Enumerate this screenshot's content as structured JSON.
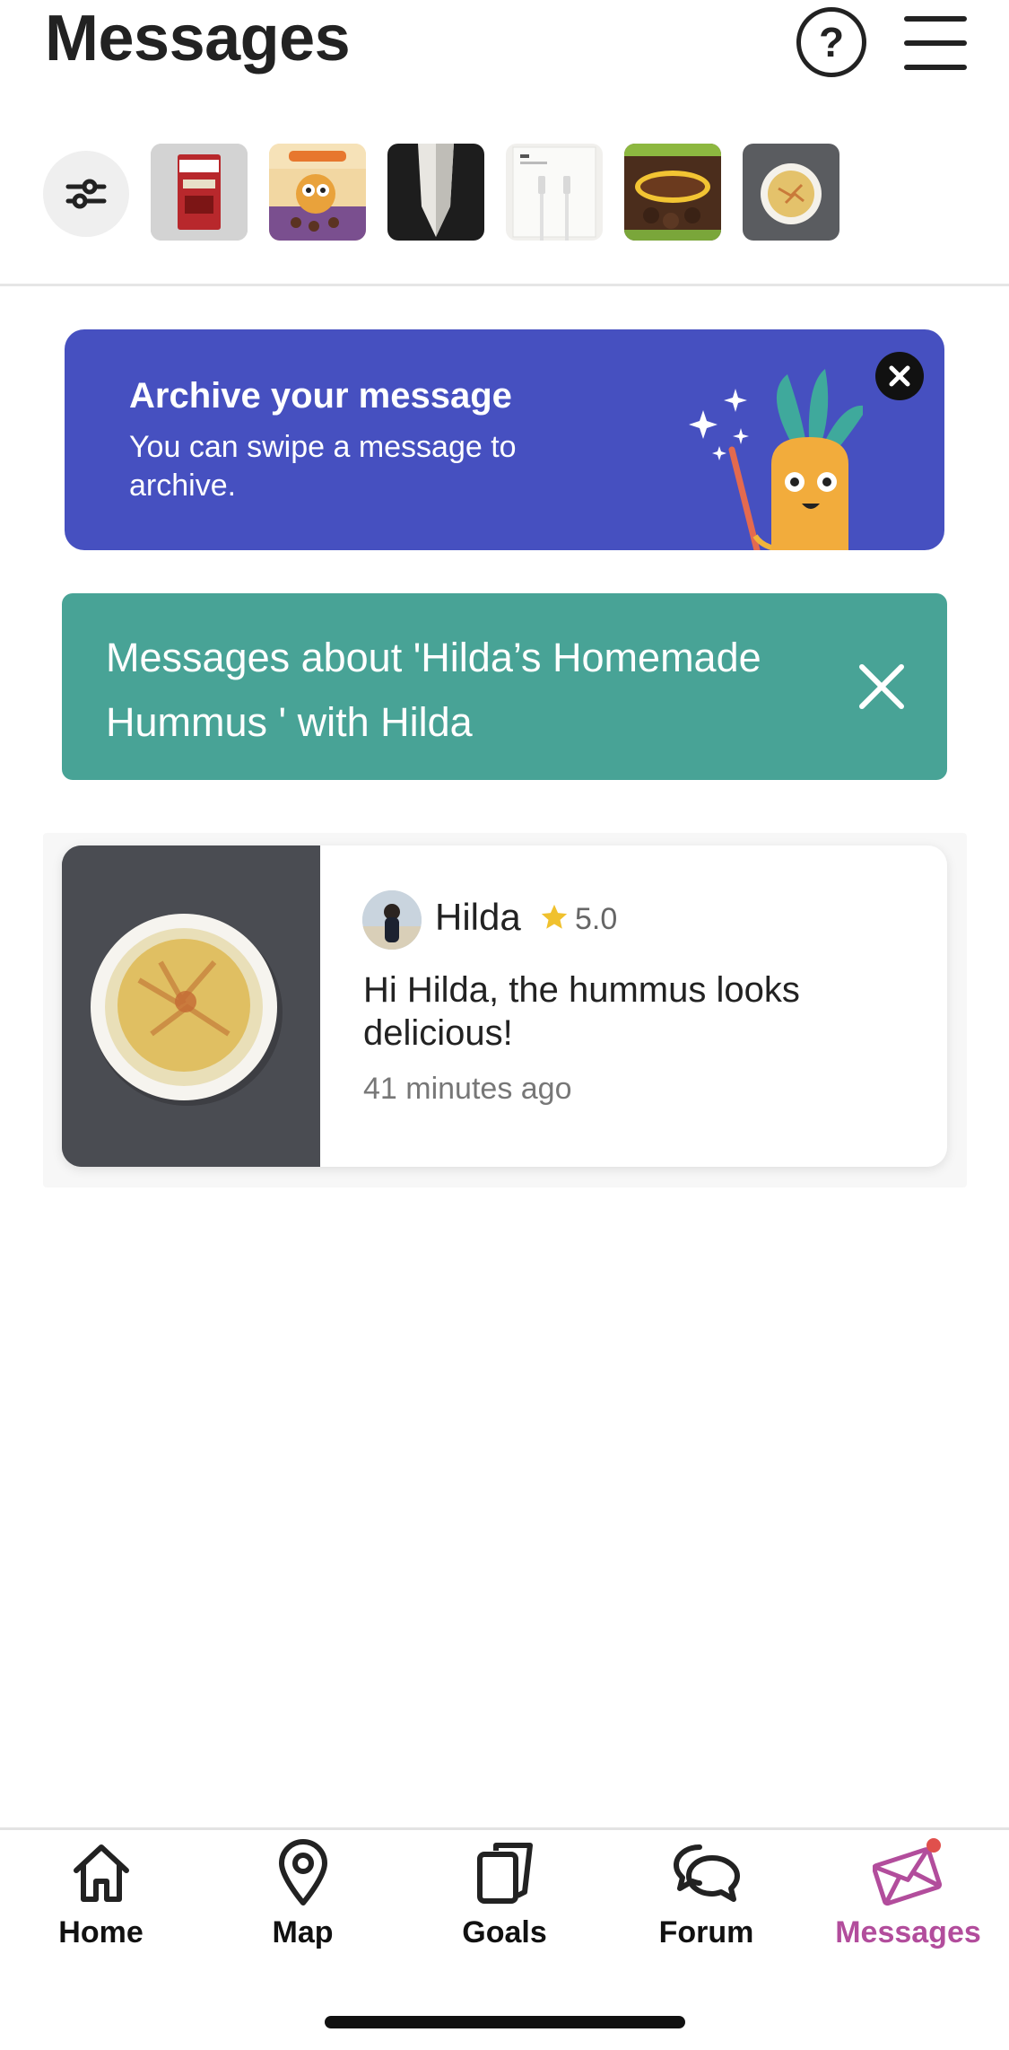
{
  "header": {
    "title": "Messages",
    "help_icon": "question-circle-icon",
    "menu_icon": "hamburger-menu-icon"
  },
  "filters": {
    "filter_icon": "sliders-icon",
    "thumbnails": [
      {
        "name": "thumbnail-ricola"
      },
      {
        "name": "thumbnail-cheeky-pops"
      },
      {
        "name": "thumbnail-black-white-item"
      },
      {
        "name": "thumbnail-usb-c-cable"
      },
      {
        "name": "thumbnail-koko-krunch"
      },
      {
        "name": "thumbnail-hummus"
      }
    ]
  },
  "archive_banner": {
    "title": "Archive your message",
    "text": "You can swipe a message to archive.",
    "close_icon": "close-circle-icon",
    "colors": {
      "background": "#4650c0"
    }
  },
  "filter_banner": {
    "text": "Messages about 'Hilda’s Homemade Hummus ' with Hilda",
    "close_icon": "close-icon",
    "colors": {
      "background": "#48a396"
    }
  },
  "conversation": {
    "sender": "Hilda",
    "rating": "5.0",
    "message": "Hi Hilda, the hummus looks delicious!",
    "time": "41 minutes ago"
  },
  "nav": {
    "items": [
      {
        "label": "Home",
        "icon": "home-icon"
      },
      {
        "label": "Map",
        "icon": "map-pin-icon"
      },
      {
        "label": "Goals",
        "icon": "goals-icon"
      },
      {
        "label": "Forum",
        "icon": "forum-icon"
      },
      {
        "label": "Messages",
        "icon": "envelope-icon",
        "active": true
      }
    ],
    "colors": {
      "active": "#b24d9c",
      "notification_dot": "#e0504c"
    }
  }
}
